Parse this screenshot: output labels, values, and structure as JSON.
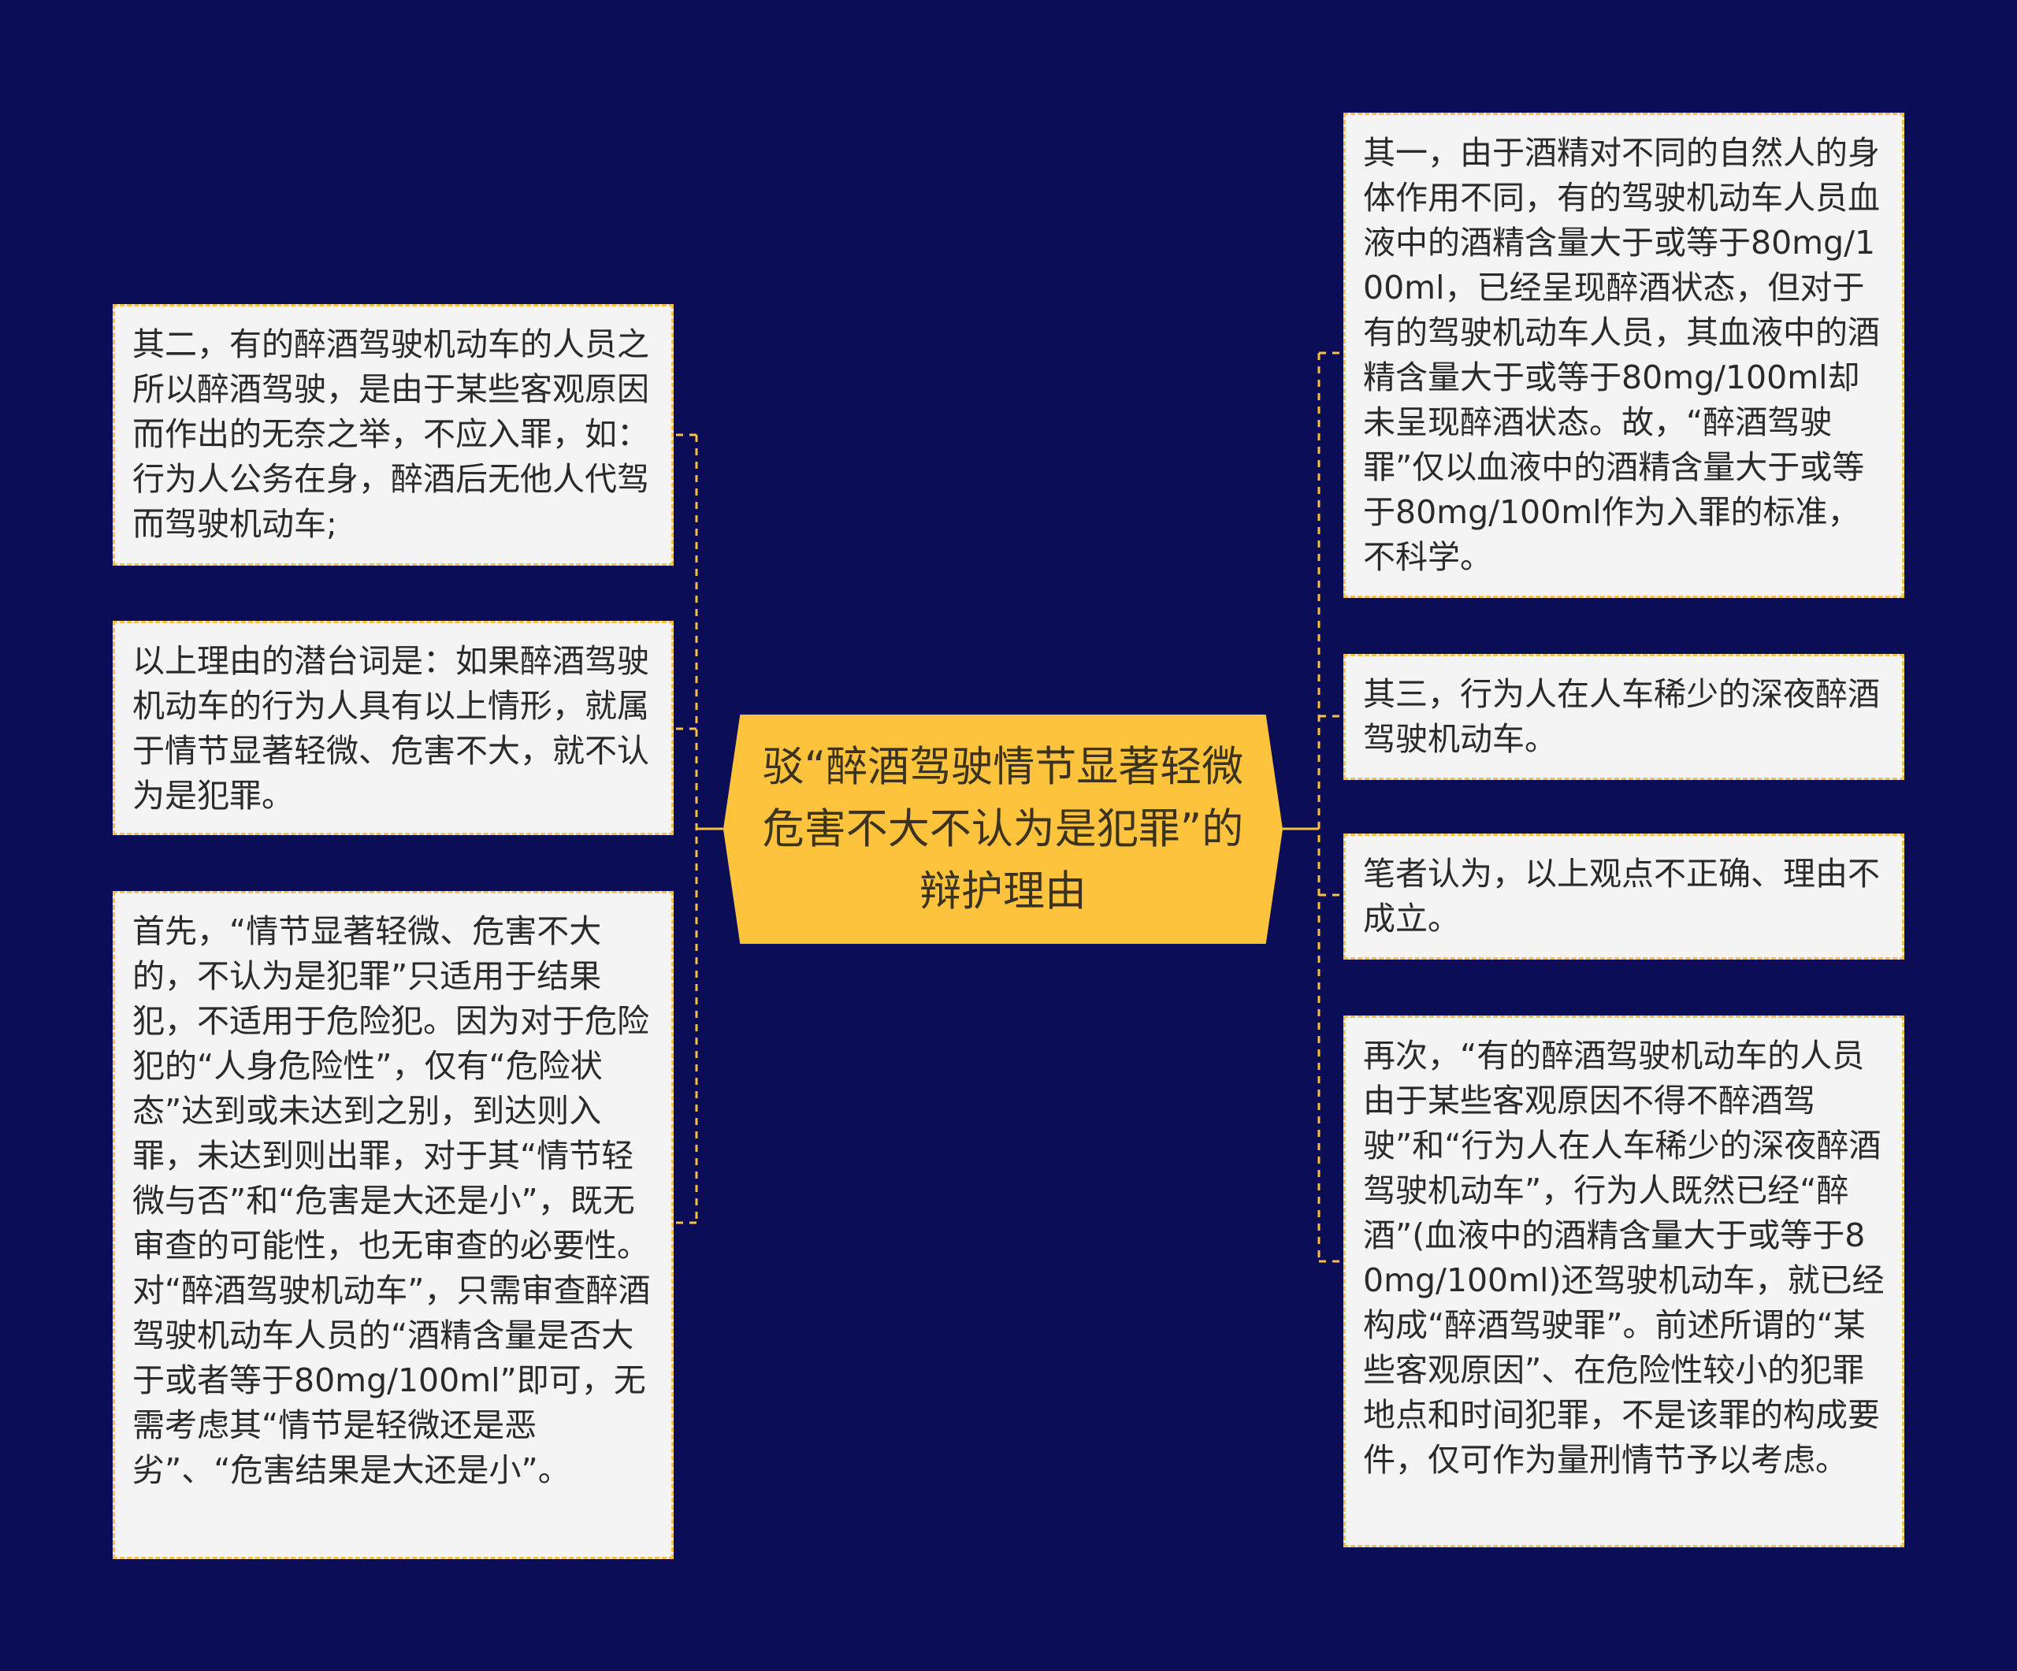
{
  "root": {
    "text": "驳“醉酒驾驶情节显著轻微危害不大不认为是犯罪”的辩护理由"
  },
  "left_nodes": [
    {
      "id": "left-1",
      "text": "其二，有的醉酒驾驶机动车的人员之所以醉酒驾驶，是由于某些客观原因而作出的无奈之举，不应入罪，如：行为人公务在身，醉酒后无他人代驾而驾驶机动车;"
    },
    {
      "id": "left-2",
      "text": "以上理由的潜台词是：如果醉酒驾驶机动车的行为人具有以上情形，就属于情节显著轻微、危害不大，就不认为是犯罪。"
    },
    {
      "id": "left-3",
      "text": "首先，“情节显著轻微、危害不大的，不认为是犯罪”只适用于结果犯，不适用于危险犯。因为对于危险犯的“人身危险性”，仅有“危险状态”达到或未达到之别，到达则入罪，未达到则出罪，对于其“情节轻微与否”和“危害是大还是小”，既无审查的可能性，也无审查的必要性。对“醉酒驾驶机动车”，只需审查醉酒驾驶机动车人员的“酒精含量是否大于或者等于80mg/100ml”即可，无需考虑其“情节是轻微还是恶劣”、“危害结果是大还是小”。"
    }
  ],
  "right_nodes": [
    {
      "id": "right-1",
      "text": "其一，由于酒精对不同的自然人的身体作用不同，有的驾驶机动车人员血液中的酒精含量大于或等于80mg/100ml，已经呈现醉酒状态，但对于有的驾驶机动车人员，其血液中的酒精含量大于或等于80mg/100ml却未呈现醉酒状态。故，“醉酒驾驶罪”仅以血液中的酒精含量大于或等于80mg/100ml作为入罪的标准，不科学。"
    },
    {
      "id": "right-2",
      "text": "其三，行为人在人车稀少的深夜醉酒驾驶机动车。"
    },
    {
      "id": "right-3",
      "text": "笔者认为，以上观点不正确、理由不成立。"
    },
    {
      "id": "right-4",
      "text": "再次，“有的醉酒驾驶机动车的人员由于某些客观原因不得不醉酒驾驶”和“行为人在人车稀少的深夜醉酒驾驶机动车”，行为人既然已经“醉酒”(血液中的酒精含量大于或等于80mg/100ml)还驾驶机动车，就已经构成“醉酒驾驶罪”。前述所谓的“某些客观原因”、在危险性较小的犯罪地点和时间犯罪，不是该罪的构成要件，仅可作为量刑情节予以考虑。"
    }
  ],
  "colors": {
    "background": "#0b0e56",
    "root_fill": "#fec33d",
    "node_fill": "#f4f4f4",
    "connector": "#f5c043"
  }
}
